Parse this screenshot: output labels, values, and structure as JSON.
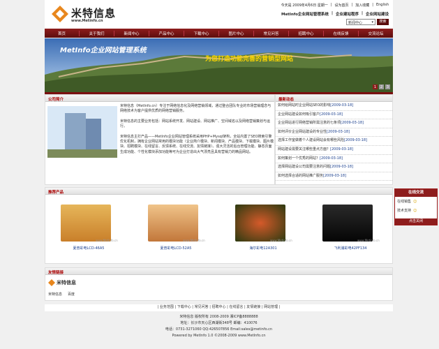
{
  "header": {
    "brand_name": "米特信息",
    "brand_url": "www.Metinfo.cn",
    "date": "今天是 2009年4月6日 星期一",
    "top_links": [
      "设为首页",
      "加入收藏",
      "English"
    ],
    "top_links2": [
      "MetInfo企业网站管理系统",
      "企业建站程序",
      "企业网站建设"
    ],
    "search_select": "新闻中心",
    "search_button": "搜索"
  },
  "nav": [
    "首页",
    "关于我们",
    "新闻中心",
    "产品中心",
    "下载中心",
    "图片中心",
    "常见问答",
    "招聘中心",
    "在线反馈",
    "交流论坛"
  ],
  "banner": {
    "text_left": "MetInfo企业网站管理系统",
    "text_right": "为您打造功能完善的营销型网站",
    "pager": [
      "1",
      "2",
      "3"
    ]
  },
  "intro": {
    "title": "公司简介",
    "p1": "米特信息（MetInfo.cn）专注于网络信息化及网络营销领域，通过整合团队专业的市场营销理念与网络技术为客户提供优质的网络营销服务。",
    "p2": "米特信息的主要业务包括：网站系统开发、网站建设、网站推广、空间域名以及网络营销策划与运行。",
    "p3": "米特信息主打产品——MetInfo企业网站管理系统采用PHP+Mysql架构，全站内置了SEO搜索引擎优化机制，拥有企业网站常用的模块功能（企业简介模块、新闻模块、产品模块、下载模块、图片模块、招聘模块、在线留言、反馈系统、在线交流、友情链接）。强大灵活的后台管理功能、静态页面生成功能、个性化模块添加功能等可为企业打造出大气漂亮且具有营销力的精品网站。"
  },
  "news": {
    "title": "最新动态",
    "items": [
      {
        "t": "如何给网站时企业网站SEO的影响",
        "d": "[2009-03-18]"
      },
      {
        "t": "企业网站建设如何吸引客户",
        "d": "[2009-03-18]"
      },
      {
        "t": "企业网站进行网络营销所需注意的七条项",
        "d": "[2009-03-18]"
      },
      {
        "t": "如何评价企业网站建设的专业性",
        "d": "[2009-03-18]"
      },
      {
        "t": "选择工作室做着个人建设网站会有哪些风险",
        "d": "[2009-03-18]"
      },
      {
        "t": "网站建设需要关注哪些重点方面？",
        "d": "[2009-03-18]"
      },
      {
        "t": "如何策划一个优秀的网站？",
        "d": "[2009-03-18]"
      },
      {
        "t": "选择网站建设公司需要注意的问题",
        "d": "[2009-03-18]"
      },
      {
        "t": "如何选择合适的网站推广服务",
        "d": "[2009-03-18]"
      }
    ]
  },
  "products": {
    "title": "推荐产品",
    "watermark": "www.Metinfo.cn",
    "items": [
      "夏普彩电LCD-46A5",
      "夏普彩电LCD-52A5",
      "海尔彩电12A301",
      "飞利浦彩电42PF134"
    ]
  },
  "links": {
    "title": "友情链接",
    "logo_text": "米特信息",
    "items": [
      "米特信息",
      "百度"
    ]
  },
  "footer_links": [
    "业务范围",
    "下载中心",
    "常见问答",
    "招聘中心",
    "在线留言",
    "友情链接",
    "网站管理"
  ],
  "copyright": {
    "line1": "米特信息 版权所有 2008-2009 湘ICP备8888888",
    "line2": "地址：长沙市天心区西湖街348号 邮编：410076",
    "line3": "电话：0731-3271060 QQ:426507856 Email:sales@metinfo.cn",
    "line4": "Powered by MetInfo 1.0 ©2008-2009 www.MetInfo.cn"
  },
  "float_panel": {
    "title": "在线交流",
    "rows": [
      "在线销售",
      "技术支持"
    ],
    "footer": "点击关闭"
  },
  "colors": {
    "primary": "#8e1d1d",
    "accent_text": "#a00000",
    "link": "#1a3f8e"
  }
}
